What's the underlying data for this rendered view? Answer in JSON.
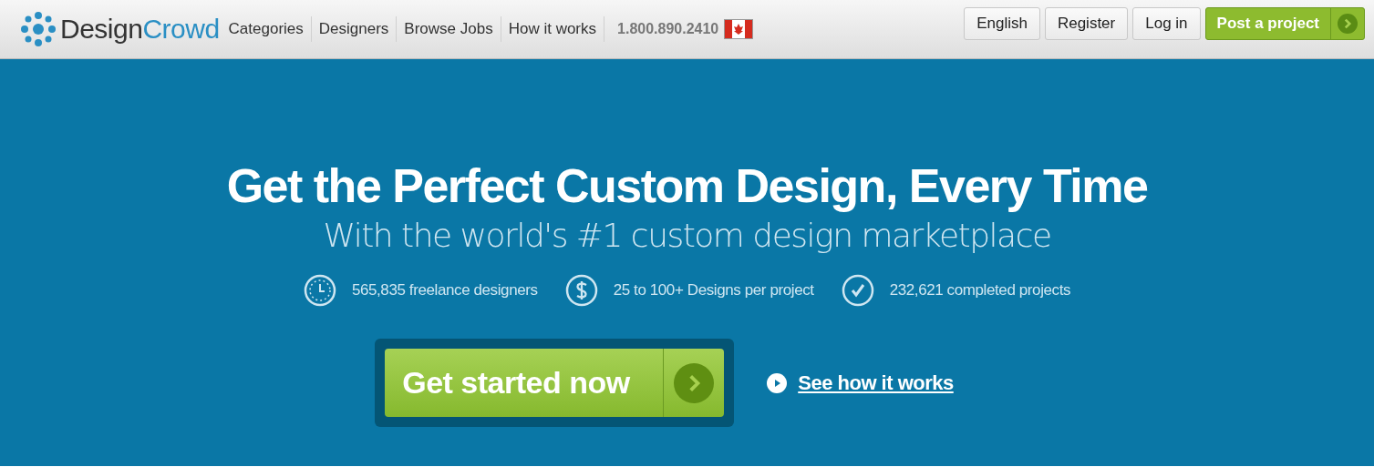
{
  "logo": {
    "first": "Design",
    "second": "Crowd"
  },
  "nav": [
    "Categories",
    "Designers",
    "Browse Jobs",
    "How it works"
  ],
  "phone": "1.800.890.2410",
  "header_buttons": [
    {
      "label": "English",
      "kind": "plain"
    },
    {
      "label": "Register",
      "kind": "plain"
    },
    {
      "label": "Log in",
      "kind": "plain"
    },
    {
      "label": "Post a project",
      "kind": "primary"
    }
  ],
  "hero": {
    "title": "Get the Perfect Custom Design, Every Time",
    "subtitle": "With the world's #1 custom design marketplace",
    "stats": [
      {
        "kind": "clock",
        "text": "565,835 freelance designers"
      },
      {
        "kind": "dollar",
        "text": "25 to 100+ Designs per project"
      },
      {
        "kind": "check",
        "text": "232,621 completed projects"
      }
    ],
    "cta": "Get started now",
    "video_link": "See how it works"
  }
}
